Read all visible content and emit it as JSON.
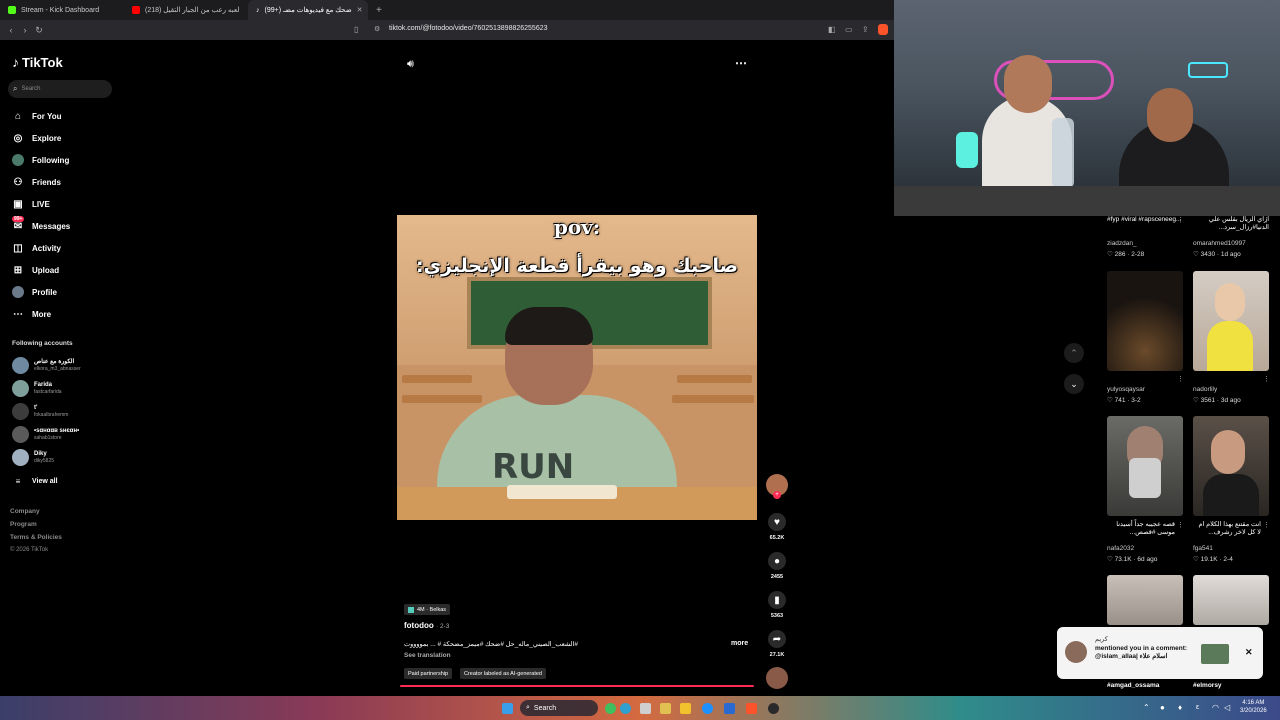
{
  "browser": {
    "tabs": [
      {
        "title": "Stream - Kick Dashboard",
        "color": "#53fc18"
      },
      {
        "title": "لعبه رعب من الجبار التقيل (218)",
        "color": "#ff0000"
      },
      {
        "title": "(99+) ضحك مع فيديوهات مضـ",
        "color": "#ffffff"
      }
    ],
    "new_tab": "+",
    "url": "tiktok.com/@fotodoo/video/7602513898826255623"
  },
  "sidebar": {
    "logo": "TikTok",
    "search_placeholder": "Search",
    "nav": [
      {
        "label": "For You",
        "icon": "home-icon"
      },
      {
        "label": "Explore",
        "icon": "compass-icon"
      },
      {
        "label": "Following",
        "icon": "following-icon"
      },
      {
        "label": "Friends",
        "icon": "friends-icon"
      },
      {
        "label": "LIVE",
        "icon": "live-icon"
      },
      {
        "label": "Messages",
        "icon": "messages-icon",
        "badge": "99+"
      },
      {
        "label": "Activity",
        "icon": "activity-icon"
      },
      {
        "label": "Upload",
        "icon": "upload-icon"
      },
      {
        "label": "Profile",
        "icon": "profile-icon"
      },
      {
        "label": "More",
        "icon": "more-icon"
      }
    ],
    "following_header": "Following accounts",
    "accounts": [
      {
        "name": "الكورة مع عناص",
        "handle": "elkora_m3_abnasser"
      },
      {
        "name": "Farida",
        "handle": "fastcarfarida"
      },
      {
        "name": "t'",
        "handle": "fokaalbrahemm"
      },
      {
        "name": "•ѕαнααв ѕнєαн•",
        "handle": "sahab1store"
      },
      {
        "name": "Diky",
        "handle": "diky5825"
      }
    ],
    "view_all": "View all",
    "footer": [
      "Company",
      "Program",
      "Terms & Policies"
    ],
    "copyright": "© 2026 TikTok"
  },
  "video": {
    "overlay_top": "pov:",
    "overlay_caption": "صاحبك وهو بيقرأ قطعة الإنجليزي:",
    "shirt_text": "RUN",
    "music": "4M · Belkas",
    "author": "fotodoo",
    "date": "· 2-3",
    "caption": "#الشعب_الصيني_ماله_حل #ضحك #ميمز_مضحكة #  ... بمووووت",
    "more": "more",
    "see_translation": "See translation",
    "chips": [
      "Paid partnership",
      "Creator labeled as AI-generated"
    ]
  },
  "actions": {
    "likes": "65.2K",
    "comments": "2455",
    "saves": "5363",
    "shares": "27.1K"
  },
  "grid": [
    {
      "caption": "#fyp #viral #rapsceneeg...",
      "user": "ziadzdan_",
      "likes": "286",
      "date": "2-28"
    },
    {
      "caption": "ازاي الزيال بقلس علي الدنيا#رزال_سرد...",
      "user": "omarahmed10997",
      "likes": "3430",
      "date": "1d ago"
    },
    {
      "caption": "",
      "user": "yulyosqaysar",
      "likes": "741",
      "date": "3-2"
    },
    {
      "caption": "",
      "user": "nadorlily",
      "likes": "3561",
      "date": "3d ago"
    },
    {
      "caption": "قصه عجيبه جداً أسيدنا موسى #قصص...",
      "user": "nafa2032",
      "likes": "73.1K",
      "date": "6d ago"
    },
    {
      "caption": "انت مقتنع بهذا الكلام ام لا كل لاخر رشرف...",
      "user": "fga541",
      "likes": "19.1K",
      "date": "2-4"
    },
    {
      "caption": "",
      "user": "#amgad_ossama",
      "likes": "",
      "date": ""
    },
    {
      "caption": "",
      "user": "#elmorsy",
      "likes": "",
      "date": ""
    }
  ],
  "notification": {
    "name": "كريم",
    "text": "mentioned you in a comment: @islam_allaa| اسلام علاء",
    "close": "✕"
  },
  "taskbar": {
    "search": "Search",
    "time": "4:16 AM",
    "date": "3/20/2026"
  }
}
